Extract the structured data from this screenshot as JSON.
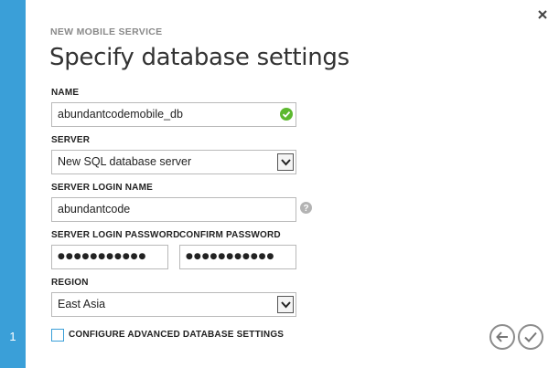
{
  "wizard": {
    "step_number": "1",
    "section_label": "NEW MOBILE SERVICE",
    "title": "Specify database settings"
  },
  "fields": {
    "name_label": "NAME",
    "name_value": "abundantcodemobile_db",
    "server_label": "SERVER",
    "server_value": "New SQL database server",
    "login_label": "SERVER LOGIN NAME",
    "login_value": "abundantcode",
    "password_label": "SERVER LOGIN PASSWORD",
    "password_value": "●●●●●●●●●●●",
    "confirm_label": "CONFIRM PASSWORD",
    "confirm_value": "●●●●●●●●●●●",
    "region_label": "REGION",
    "region_value": "East Asia"
  },
  "advanced": {
    "checkbox_label": "CONFIGURE ADVANCED DATABASE SETTINGS",
    "checked": false
  },
  "icons": {
    "close": "close-icon",
    "valid": "checkmark-circle-icon",
    "help": "question-icon",
    "back": "back-arrow-icon",
    "finish": "checkmark-icon"
  },
  "colors": {
    "accent": "#3a9fd8",
    "valid": "#5cb82e",
    "muted": "#8a8a8a"
  }
}
